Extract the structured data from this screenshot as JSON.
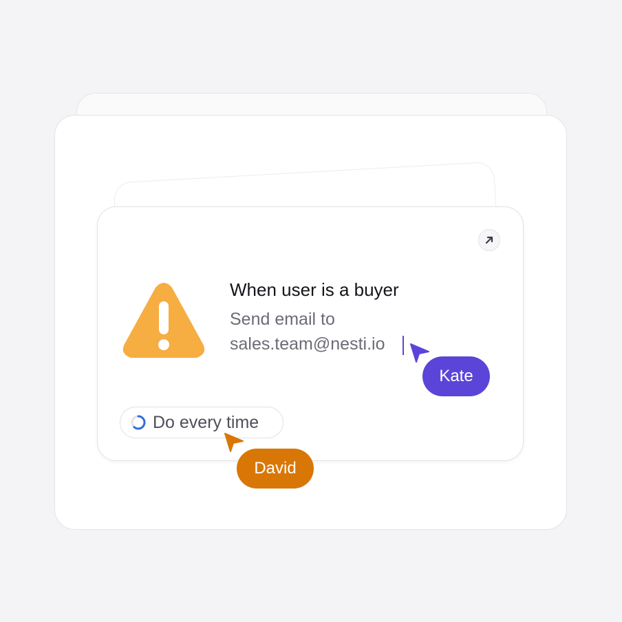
{
  "rule": {
    "title": "When user is a buyer",
    "action_line1": "Send email to",
    "action_line2": "sales.team@nesti.io"
  },
  "frequency": {
    "label": "Do every time"
  },
  "collaborators": [
    {
      "name": "Kate",
      "color": "#5a45d8"
    },
    {
      "name": "David",
      "color": "#d97706"
    }
  ],
  "icons": {
    "expand": "arrow-up-right-icon",
    "warning": "warning-icon",
    "frequency": "loop-spinner-icon",
    "cursor": "pointer-cursor-icon"
  },
  "colors": {
    "warning": "#f6ad42",
    "spinner": "#2f6fd6",
    "background": "#f4f4f6"
  }
}
